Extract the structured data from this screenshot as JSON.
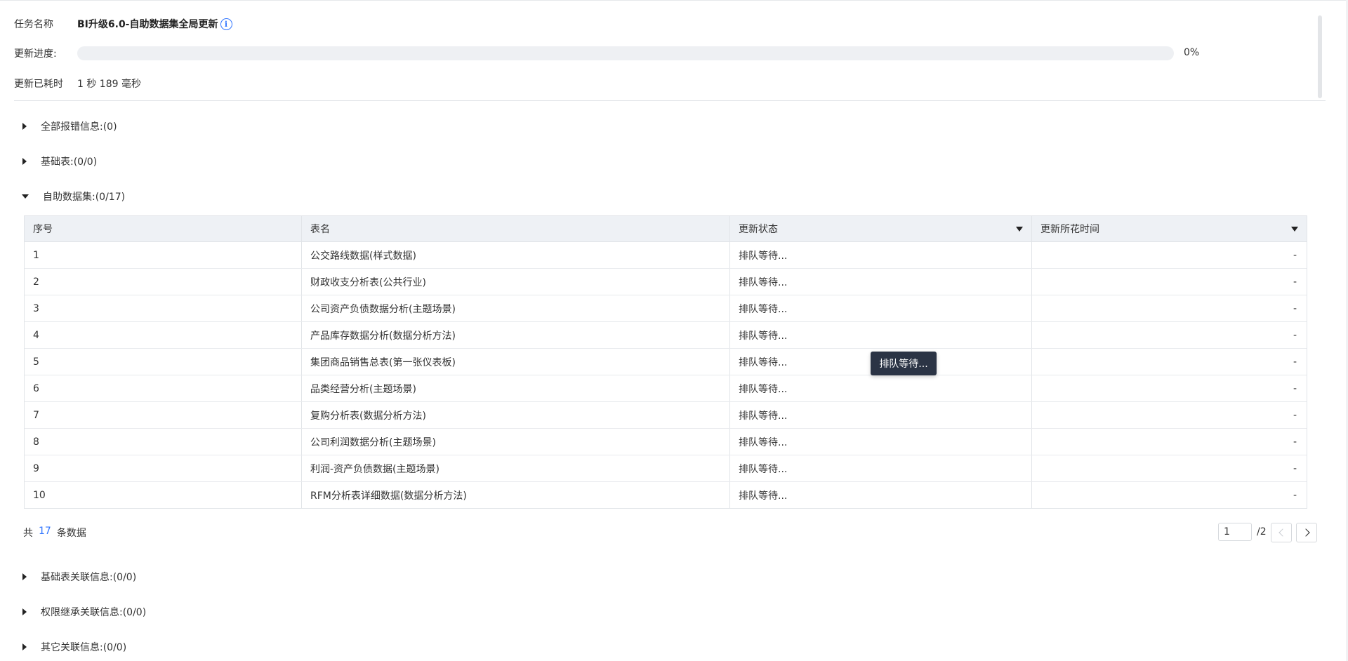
{
  "task": {
    "name_label": "任务名称",
    "name_value": "BI升级6.0-自助数据集全局更新",
    "progress_label": "更新进度:",
    "progress_percent": "0%",
    "progress_fraction": 0,
    "elapsed_label": "更新已耗时",
    "elapsed_value": "1 秒 189 毫秒"
  },
  "icons": {
    "info": "info-circle-icon"
  },
  "colors": {
    "accent": "#3377ff",
    "tooltip_bg": "#2b3445",
    "header_bg": "#eef1f5"
  },
  "sections": {
    "all_errors": "全部报错信息:(0)",
    "base_tables": "基础表:(0/0)",
    "self_datasets": "自助数据集:(0/17)",
    "base_relations": "基础表关联信息:(0/0)",
    "permission_relations": "权限继承关联信息:(0/0)",
    "other_relations": "其它关联信息:(0/0)"
  },
  "table": {
    "columns": [
      "序号",
      "表名",
      "更新状态",
      "更新所花时间"
    ],
    "rows": [
      {
        "index": "1",
        "name": "公交路线数据(样式数据)",
        "status": "排队等待...",
        "time": "-"
      },
      {
        "index": "2",
        "name": "财政收支分析表(公共行业)",
        "status": "排队等待...",
        "time": "-"
      },
      {
        "index": "3",
        "name": "公司资产负债数据分析(主题场景)",
        "status": "排队等待...",
        "time": "-"
      },
      {
        "index": "4",
        "name": "产品库存数据分析(数据分析方法)",
        "status": "排队等待...",
        "time": "-"
      },
      {
        "index": "5",
        "name": "集团商品销售总表(第一张仪表板)",
        "status": "排队等待...",
        "time": "-"
      },
      {
        "index": "6",
        "name": "品类经营分析(主题场景)",
        "status": "排队等待...",
        "time": "-"
      },
      {
        "index": "7",
        "name": "复购分析表(数据分析方法)",
        "status": "排队等待...",
        "time": "-"
      },
      {
        "index": "8",
        "name": "公司利润数据分析(主题场景)",
        "status": "排队等待...",
        "time": "-"
      },
      {
        "index": "9",
        "name": "利润-资产负债数据(主题场景)",
        "status": "排队等待...",
        "time": "-"
      },
      {
        "index": "10",
        "name": "RFM分析表详细数据(数据分析方法)",
        "status": "排队等待...",
        "time": "-"
      }
    ]
  },
  "tooltip": "排队等待...",
  "pagination": {
    "total_prefix": "共",
    "total_count": "17",
    "total_suffix": "条数据",
    "current_page": "1",
    "total_pages": "/2"
  }
}
